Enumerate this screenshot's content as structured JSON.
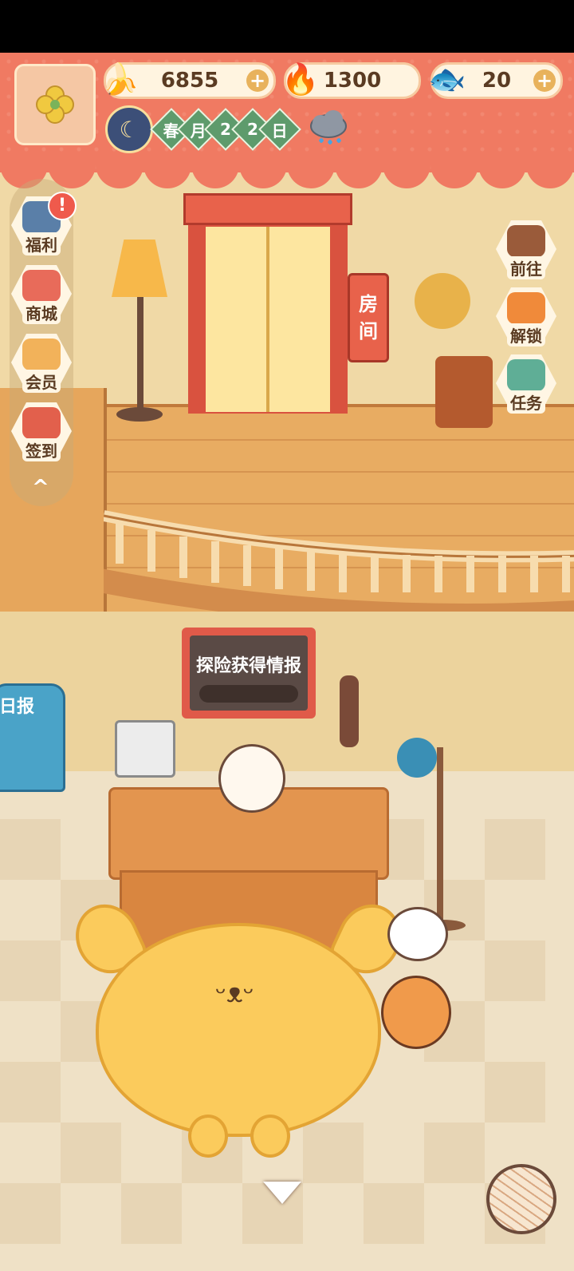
{
  "header": {
    "resources": [
      {
        "name": "banana",
        "value": "6855",
        "icon": "banana-icon",
        "has_plus": true
      },
      {
        "name": "fire-fish",
        "value": "1300",
        "icon": "fire-fish-icon",
        "has_plus": false
      },
      {
        "name": "blue-fish",
        "value": "20",
        "icon": "blue-fish-icon",
        "has_plus": true
      }
    ],
    "date": {
      "chars": [
        "春",
        "月",
        "2",
        "2",
        "日"
      ],
      "time_icon": "moon-icon",
      "weather_icon": "rain-cloud-icon"
    }
  },
  "left_menu": [
    {
      "label": "福利",
      "icon": "tv-icon",
      "badge": "!"
    },
    {
      "label": "商城",
      "icon": "shop-icon"
    },
    {
      "label": "会员",
      "icon": "member-icon"
    },
    {
      "label": "签到",
      "icon": "checkin-icon"
    }
  ],
  "left_menu_collapse": "^",
  "right_menu": [
    {
      "label": "前往",
      "icon": "signboard-icon"
    },
    {
      "label": "解锁",
      "icon": "key-icon"
    },
    {
      "label": "任务",
      "icon": "scroll-icon"
    }
  ],
  "scene": {
    "room_sign": [
      "房",
      "间"
    ],
    "board_title": "探险获得情报",
    "newspaper_label": "日报",
    "rug_face": "ᵕᴥᵕ"
  },
  "colors": {
    "banner": "#f07a62",
    "wall": "#f0d9a6",
    "floor": "#e8ac62",
    "accent_green": "#5e9b6c"
  }
}
